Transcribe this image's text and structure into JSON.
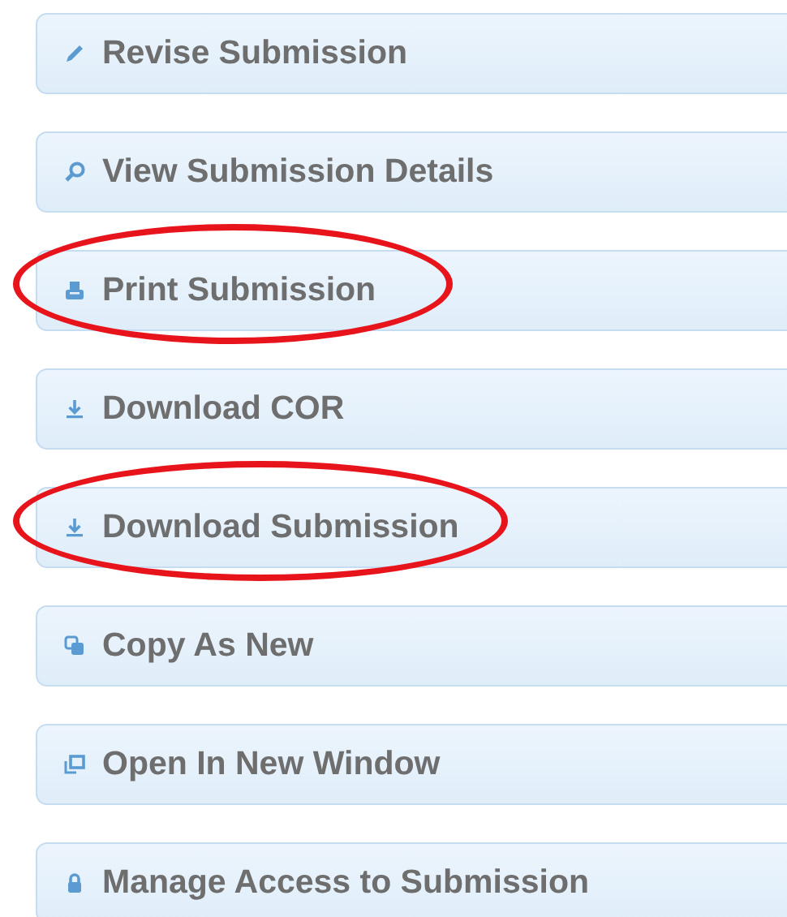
{
  "actions": [
    {
      "label": "Revise Submission",
      "circled": false
    },
    {
      "label": "View Submission Details",
      "circled": false
    },
    {
      "label": "Print Submission",
      "circled": true
    },
    {
      "label": "Download COR",
      "circled": false
    },
    {
      "label": "Download Submission",
      "circled": true
    },
    {
      "label": "Copy As New",
      "circled": false
    },
    {
      "label": "Open In New Window",
      "circled": false
    },
    {
      "label": "Manage Access to Submission",
      "circled": false
    }
  ]
}
